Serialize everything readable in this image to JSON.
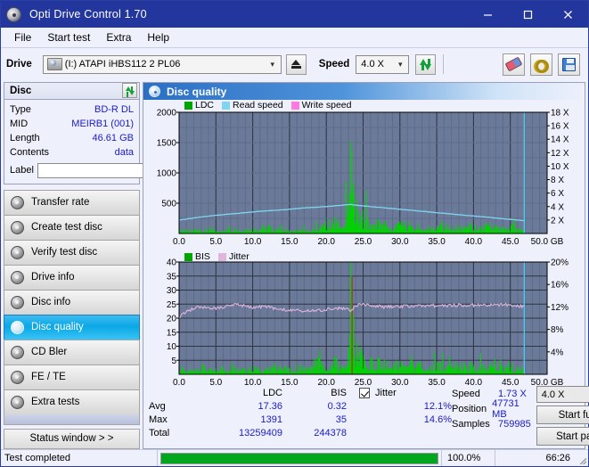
{
  "window": {
    "title": "Opti Drive Control 1.70",
    "icon": "disc-icon",
    "minimize": "minimize-icon",
    "maximize": "maximize-icon",
    "close": "close-icon"
  },
  "menu": {
    "items": [
      "File",
      "Start test",
      "Extra",
      "Help"
    ]
  },
  "toolbar": {
    "drive_label": "Drive",
    "drive_value": "(I:)   ATAPI iHBS112  2 PL06",
    "eject": "eject-icon",
    "speed_label": "Speed",
    "speed_value": "4.0 X",
    "refresh": "refresh-icon",
    "eraser": "eraser-icon",
    "wrench": "wrench-icon",
    "save": "save-icon"
  },
  "disc": {
    "header": "Disc",
    "refresh": "refresh-icon",
    "rows": [
      {
        "key": "Type",
        "value": "BD-R DL"
      },
      {
        "key": "MID",
        "value": "MEIRB1 (001)"
      },
      {
        "key": "Length",
        "value": "46.61 GB"
      },
      {
        "key": "Contents",
        "value": "data"
      }
    ],
    "label_key": "Label",
    "label_value": "",
    "label_button": "disc-icon"
  },
  "sidebar": {
    "items": [
      {
        "label": "Transfer rate",
        "active": false
      },
      {
        "label": "Create test disc",
        "active": false
      },
      {
        "label": "Verify test disc",
        "active": false
      },
      {
        "label": "Drive info",
        "active": false
      },
      {
        "label": "Disc info",
        "active": false
      },
      {
        "label": "Disc quality",
        "active": true
      },
      {
        "label": "CD Bler",
        "active": false
      },
      {
        "label": "FE / TE",
        "active": false
      },
      {
        "label": "Extra tests",
        "active": false
      }
    ],
    "status_window": "Status window > >"
  },
  "panel": {
    "title": "Disc quality",
    "icon": "disc-quality-icon"
  },
  "chart_data": [
    {
      "type": "area",
      "title": "LDC / Read speed",
      "xlabel": "GB",
      "ylabel": "LDC",
      "xlim": [
        0,
        50
      ],
      "ylim": [
        0,
        2000
      ],
      "xticks": [
        "0.0",
        "5.0",
        "10.0",
        "15.0",
        "20.0",
        "25.0",
        "30.0",
        "35.0",
        "40.0",
        "45.0",
        "50.0 GB"
      ],
      "yticks_left": [
        "500",
        "1000",
        "1500",
        "2000"
      ],
      "yticks_right": [
        "2 X",
        "4 X",
        "6 X",
        "8 X",
        "10 X",
        "12 X",
        "14 X",
        "16 X",
        "18 X"
      ],
      "y2lim": [
        0,
        18
      ],
      "grid": true,
      "legend": [
        {
          "name": "LDC",
          "color": "#00a600"
        },
        {
          "name": "Read speed",
          "color": "#7fd4f0"
        },
        {
          "name": "Write speed",
          "color": "#ff7ae0"
        }
      ],
      "series": [
        {
          "name": "LDC",
          "color": "#00d400",
          "x": [
            0.3,
            1.0,
            1.8,
            2.6,
            3.4,
            4.2,
            5.0,
            5.8,
            6.6,
            7.4,
            8.2,
            9.0,
            9.8,
            10.6,
            11.4,
            12.2,
            13.0,
            13.8,
            14.6,
            15.4,
            16.2,
            17.0,
            17.8,
            18.6,
            19.4,
            20.2,
            21.0,
            21.8,
            22.6,
            23.1,
            23.4,
            23.7,
            24.0,
            24.4,
            24.8,
            25.4,
            26.0,
            27.0,
            28.0,
            29.0,
            30.0,
            31.0,
            32.0,
            33.0,
            34.0,
            35.0,
            36.0,
            37.0,
            38.0,
            39.0,
            40.0,
            41.0,
            42.0,
            43.0,
            44.0,
            45.0,
            46.0,
            46.8
          ],
          "values": [
            40,
            55,
            48,
            62,
            50,
            70,
            58,
            44,
            90,
            62,
            55,
            78,
            66,
            52,
            88,
            70,
            60,
            96,
            74,
            58,
            110,
            86,
            68,
            130,
            104,
            150,
            180,
            240,
            320,
            760,
            1391,
            560,
            410,
            330,
            290,
            250,
            200,
            170,
            150,
            140,
            135,
            130,
            128,
            120,
            118,
            115,
            112,
            110,
            108,
            105,
            104,
            102,
            100,
            98,
            96,
            94,
            92,
            88
          ]
        },
        {
          "name": "Read speed",
          "color": "#7fd4f0",
          "x": [
            0,
            2,
            5,
            8,
            11,
            14,
            17,
            20,
            23,
            23.3,
            25,
            28,
            31,
            34,
            37,
            40,
            43,
            46,
            46.9
          ],
          "values": [
            2.0,
            2.3,
            2.7,
            3.0,
            3.3,
            3.5,
            3.8,
            4.0,
            4.3,
            4.3,
            4.1,
            3.8,
            3.5,
            3.2,
            2.9,
            2.6,
            2.3,
            2.0,
            1.9
          ]
        },
        {
          "name": "scan-end-marker",
          "color": "#48cdf0",
          "x": [
            46.9
          ],
          "values": [
            18
          ]
        }
      ]
    },
    {
      "type": "area",
      "title": "BIS / Jitter",
      "xlabel": "GB",
      "ylabel": "BIS",
      "xlim": [
        0,
        50
      ],
      "ylim": [
        0,
        40
      ],
      "xticks": [
        "0.0",
        "5.0",
        "10.0",
        "15.0",
        "20.0",
        "25.0",
        "30.0",
        "35.0",
        "40.0",
        "45.0",
        "50.0 GB"
      ],
      "yticks_left": [
        "5",
        "10",
        "15",
        "20",
        "25",
        "30",
        "35",
        "40"
      ],
      "yticks_right": [
        "4%",
        "8%",
        "12%",
        "16%",
        "20%"
      ],
      "y2lim": [
        0,
        20
      ],
      "grid": true,
      "legend": [
        {
          "name": "BIS",
          "color": "#00a600"
        },
        {
          "name": "Jitter",
          "color": "#dfb5dc"
        }
      ],
      "series": [
        {
          "name": "BIS",
          "color": "#00d400",
          "x": [
            0.4,
            1.2,
            2.0,
            2.8,
            3.6,
            4.4,
            5.2,
            6.0,
            6.8,
            7.6,
            8.4,
            9.2,
            10.0,
            10.8,
            11.6,
            12.4,
            13.2,
            14.0,
            14.8,
            15.6,
            16.4,
            17.2,
            18.0,
            18.8,
            19.6,
            20.4,
            21.2,
            22.0,
            22.8,
            23.2,
            23.5,
            23.8,
            24.2,
            24.8,
            25.6,
            26.5,
            27.5,
            28.5,
            29.5,
            30.5,
            31.5,
            32.5,
            33.5,
            34.5,
            35.5,
            36.5,
            37.5,
            38.5,
            39.5,
            40.5,
            41.5,
            42.5,
            43.5,
            44.5,
            45.5,
            46.5,
            46.9
          ],
          "values": [
            2.0,
            1.6,
            2.2,
            1.4,
            2.5,
            1.8,
            1.3,
            2.1,
            1.5,
            2.4,
            1.6,
            1.9,
            2.6,
            1.4,
            2.0,
            1.7,
            2.8,
            1.5,
            2.2,
            1.8,
            2.6,
            1.6,
            2.4,
            5.2,
            1.9,
            2.2,
            4.6,
            2.0,
            3.4,
            9.8,
            35,
            10.2,
            8.4,
            6.2,
            4.8,
            4.2,
            3.8,
            3.6,
            3.4,
            3.3,
            3.2,
            3.1,
            3.0,
            3.0,
            2.9,
            2.9,
            2.8,
            2.8,
            2.7,
            2.7,
            2.6,
            2.6,
            2.5,
            2.5,
            2.4,
            2.4,
            2.3
          ]
        },
        {
          "name": "Jitter",
          "color": "#dfb5dc",
          "x": [
            0,
            0.6,
            1.2,
            2.0,
            3.0,
            4.0,
            5.0,
            6.0,
            7.0,
            8.0,
            9.0,
            10.0,
            11.0,
            12.0,
            13.0,
            14.0,
            15.0,
            16.0,
            17.0,
            18.0,
            19.0,
            20.0,
            21.0,
            22.0,
            23.0,
            23.4,
            24.0,
            25.0,
            26.0,
            27.0,
            28.0,
            29.0,
            30.0,
            31.0,
            32.0,
            33.0,
            34.0,
            35.0,
            36.0,
            37.0,
            38.0,
            39.0,
            40.0,
            41.0,
            42.0,
            43.0,
            44.0,
            45.0,
            46.0,
            46.8
          ],
          "values": [
            20.2,
            21.5,
            22.6,
            23.6,
            24.2,
            23.6,
            23.4,
            23.8,
            24.5,
            24.8,
            24.3,
            23.9,
            24.0,
            24.2,
            23.4,
            23.0,
            22.8,
            22.7,
            22.6,
            22.5,
            22.7,
            23.0,
            23.4,
            23.6,
            23.1,
            22.6,
            24.6,
            24.8,
            24.4,
            24.2,
            24.0,
            24.1,
            24.3,
            24.2,
            24.4,
            24.5,
            24.6,
            24.4,
            24.5,
            24.6,
            24.7,
            24.5,
            24.6,
            24.8,
            24.6,
            24.7,
            24.9,
            24.6,
            24.4,
            24.2
          ]
        },
        {
          "name": "scan-end-marker",
          "color": "#48cdf0",
          "x": [
            46.9
          ],
          "values": [
            40
          ]
        }
      ]
    }
  ],
  "stats": {
    "col_headers": [
      "LDC",
      "BIS"
    ],
    "rows": [
      {
        "label": "Avg",
        "ldc": "17.36",
        "bis": "0.32"
      },
      {
        "label": "Max",
        "ldc": "1391",
        "bis": "35"
      },
      {
        "label": "Total",
        "ldc": "13259409",
        "bis": "244378"
      }
    ],
    "jitter_label": "Jitter",
    "jitter_checked": true,
    "jitter_avg": "12.1%",
    "jitter_max": "14.6%",
    "speed_label": "Speed",
    "speed_value": "1.73 X",
    "position_label": "Position",
    "position_value": "47731 MB",
    "samples_label": "Samples",
    "samples_value": "759985",
    "speed_select": "4.0 X",
    "start_full": "Start full",
    "start_part": "Start part"
  },
  "statusbar": {
    "message": "Test completed",
    "progress_percent": "100.0%",
    "progress_value": 100,
    "elapsed": "66:26"
  }
}
